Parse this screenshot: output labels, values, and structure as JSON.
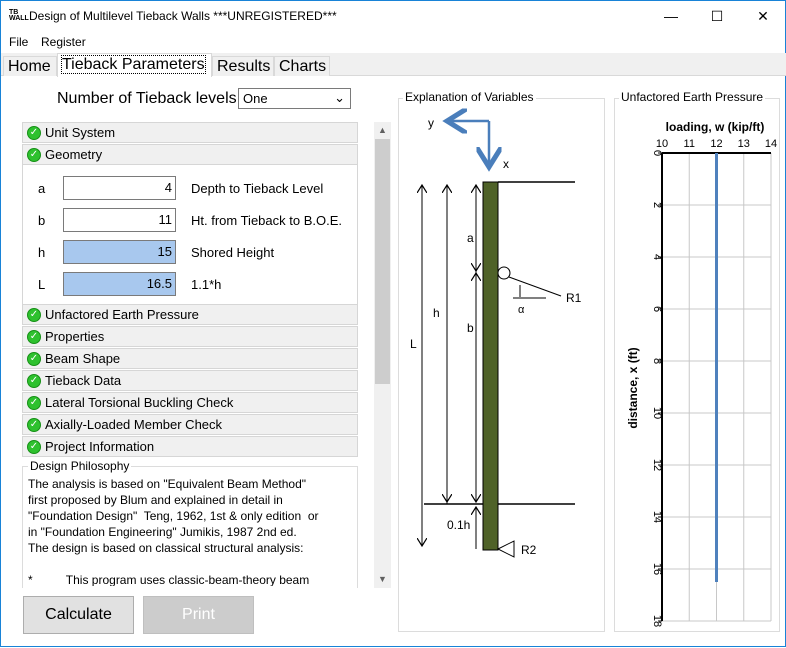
{
  "window": {
    "title": "Design of Multilevel Tieback Walls  ***UNREGISTERED***",
    "logo": "TB WALL"
  },
  "menu": [
    "File",
    "Register"
  ],
  "tabs": [
    "Home",
    "Tieback Parameters",
    "Results",
    "Charts"
  ],
  "active_tab": "Tieback Parameters",
  "tieback_levels": {
    "label": "Number of Tieback levels",
    "value": "One"
  },
  "sections_top": [
    "Unit System",
    "Geometry"
  ],
  "geometry": [
    {
      "sym": "a",
      "value": "4",
      "desc": "Depth to Tieback Level",
      "computed": false
    },
    {
      "sym": "b",
      "value": "11",
      "desc": "Ht. from Tieback to B.O.E.",
      "computed": false
    },
    {
      "sym": "h",
      "value": "15",
      "desc": "Shored Height",
      "computed": true
    },
    {
      "sym": "L",
      "value": "16.5",
      "desc": "1.1*h",
      "computed": true
    }
  ],
  "sections_bottom": [
    "Unfactored Earth Pressure",
    "Properties",
    "Beam Shape",
    "Tieback Data",
    "Lateral Torsional Buckling Check",
    "Axially-Loaded Member Check",
    "Project Information"
  ],
  "philosophy": {
    "title": "Design Philosophy",
    "text": "The analysis is based on \"Equivalent Beam Method\"\nfirst proposed by Blum and explained in detail in\n\"Foundation Design\"  Teng, 1962, 1st & only edition  or\nin \"Foundation Engineering\" Jumikis, 1987 2nd ed.\nThe design is based on classical structural analysis:\n\n*          This program uses classic-beam-theory beam"
  },
  "buttons": {
    "calculate": "Calculate",
    "print": "Print"
  },
  "diagram": {
    "title": "Explanation of Variables",
    "labels": {
      "y": "y",
      "x": "x",
      "a": "a",
      "b": "b",
      "h": "h",
      "L": "L",
      "R1": "R1",
      "R2": "R2",
      "alpha": "α",
      "pt1h": "0.1h"
    },
    "wall_color": "#4f6228",
    "axis_color": "#4a7ebb"
  },
  "chart_panel": {
    "title": "Unfactored Earth Pressure"
  },
  "chart_data": {
    "type": "line",
    "xlabel": "loading, w (kip/ft)",
    "ylabel": "distance, x (ft)",
    "xlim": [
      10,
      14
    ],
    "ylim": [
      0,
      18
    ],
    "x_ticks": [
      10,
      11,
      12,
      13,
      14
    ],
    "y_ticks": [
      0,
      2,
      4,
      6,
      8,
      10,
      12,
      14,
      16,
      18
    ],
    "y_reversed": true,
    "grid": true,
    "series": [
      {
        "x": [
          12,
          12
        ],
        "y": [
          0,
          16.5
        ],
        "color": "#4f81bd"
      }
    ]
  }
}
